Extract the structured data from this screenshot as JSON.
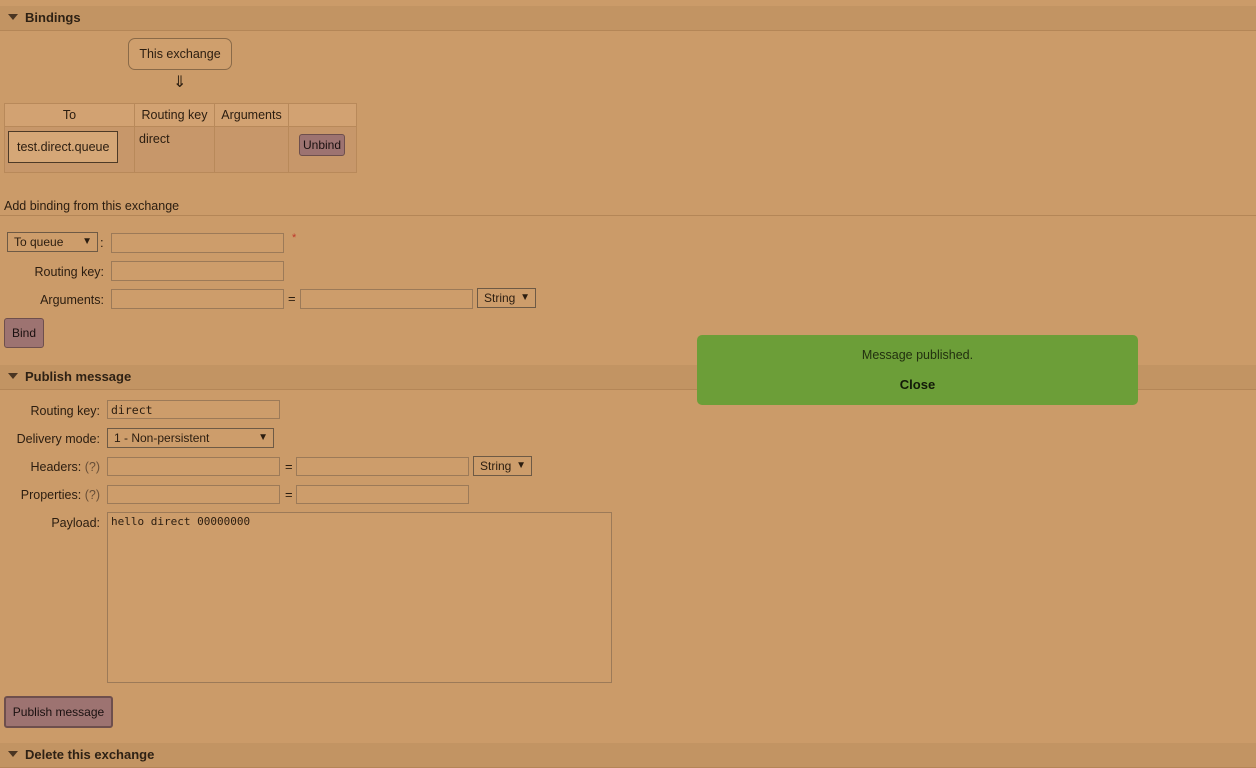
{
  "bindings": {
    "section_title": "Bindings",
    "source_label": "This exchange",
    "arrow": "⇓",
    "table": {
      "headers": [
        "To",
        "Routing key",
        "Arguments",
        ""
      ],
      "rows": [
        {
          "to": "test.direct.queue",
          "routing_key": "direct",
          "arguments": "",
          "action": "Unbind"
        }
      ]
    }
  },
  "add_binding": {
    "title": "Add binding from this exchange",
    "destination_type": "To queue",
    "colon": ":",
    "required_mark": "*",
    "destination_value": "",
    "routing_key_label": "Routing key:",
    "routing_key_value": "",
    "arguments_label": "Arguments:",
    "argument_key": "",
    "equals": "=",
    "argument_value": "",
    "argument_type": "String",
    "bind_button": "Bind"
  },
  "publish": {
    "section_title": "Publish message",
    "routing_key_label": "Routing key:",
    "routing_key_value": "direct",
    "delivery_mode_label": "Delivery mode:",
    "delivery_mode_value": "1 - Non-persistent",
    "headers_label": "Headers:",
    "help_mark": "(?)",
    "headers_type": "String",
    "equals": "=",
    "properties_label": "Properties:",
    "payload_label": "Payload:",
    "payload_value": "hello direct 00000000",
    "publish_button": "Publish message"
  },
  "toast": {
    "message": "Message published.",
    "close_label": "Close"
  },
  "delete_section": {
    "section_title": "Delete this exchange"
  }
}
